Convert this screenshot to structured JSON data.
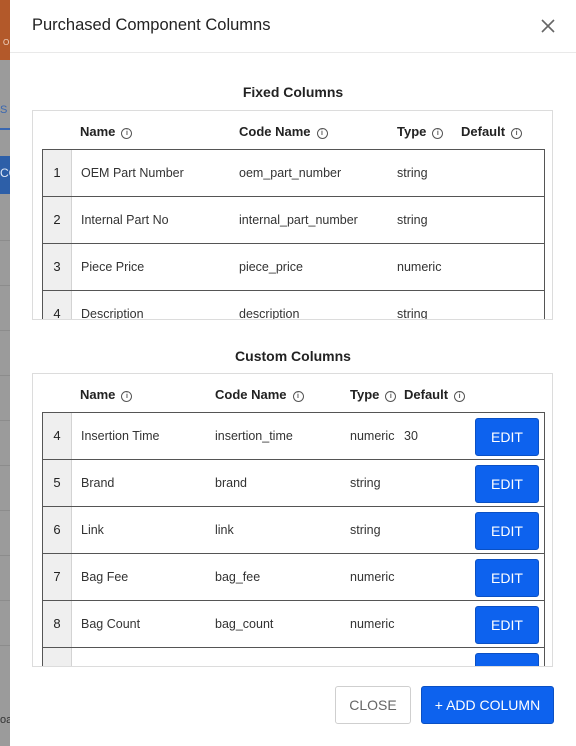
{
  "background": {
    "orange_text": "O",
    "tab_text": "S",
    "blue_text": "CO",
    "bottom_text": "oa"
  },
  "modal": {
    "title": "Purchased Component Columns",
    "close_icon": "close-x-icon"
  },
  "fixed": {
    "title": "Fixed Columns",
    "headers": {
      "name": "Name",
      "code": "Code Name",
      "type": "Type",
      "default": "Default"
    },
    "rows": [
      {
        "num": "1",
        "name": "OEM Part Number",
        "code": "oem_part_number",
        "type": "string",
        "default": ""
      },
      {
        "num": "2",
        "name": "Internal Part No",
        "code": "internal_part_number",
        "type": "string",
        "default": ""
      },
      {
        "num": "3",
        "name": "Piece Price",
        "code": "piece_price",
        "type": "numeric",
        "default": ""
      },
      {
        "num": "4",
        "name": "Description",
        "code": "description",
        "type": "string",
        "default": ""
      }
    ]
  },
  "custom": {
    "title": "Custom Columns",
    "headers": {
      "name": "Name",
      "code": "Code Name",
      "type": "Type",
      "default": "Default"
    },
    "edit_label": "EDIT",
    "rows": [
      {
        "num": "4",
        "name": "Insertion Time",
        "code": "insertion_time",
        "type": "numeric",
        "default": "30"
      },
      {
        "num": "5",
        "name": "Brand",
        "code": "brand",
        "type": "string",
        "default": ""
      },
      {
        "num": "6",
        "name": "Link",
        "code": "link",
        "type": "string",
        "default": ""
      },
      {
        "num": "7",
        "name": "Bag Fee",
        "code": "bag_fee",
        "type": "numeric",
        "default": ""
      },
      {
        "num": "8",
        "name": "Bag Count",
        "code": "bag_count",
        "type": "numeric",
        "default": ""
      }
    ]
  },
  "footer": {
    "close_label": "CLOSE",
    "add_label": "+ ADD COLUMN"
  },
  "colors": {
    "accent": "#0d62ee"
  }
}
